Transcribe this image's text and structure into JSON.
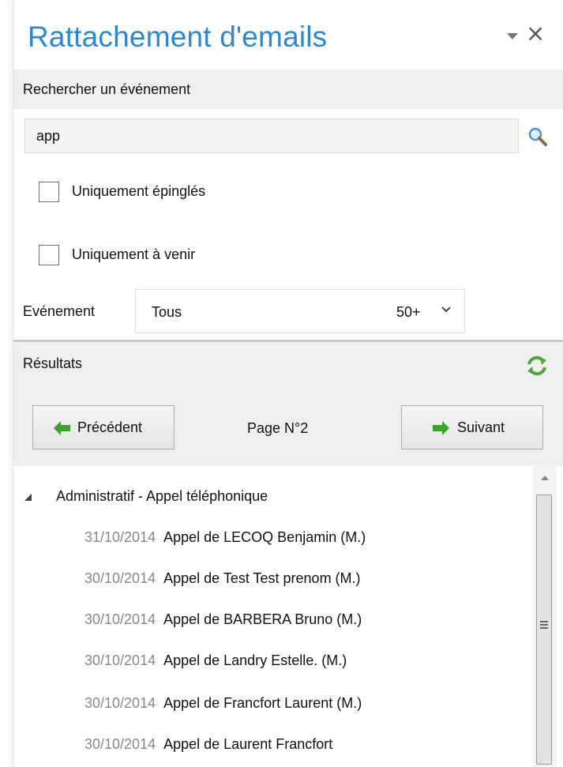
{
  "panel": {
    "title": "Rattachement d'emails",
    "close_glyph": "×"
  },
  "search_section": {
    "header": "Rechercher un événement",
    "input_value": "app",
    "search_icon": "search-icon"
  },
  "filters": {
    "pinned_only": {
      "label": "Uniquement épinglés",
      "checked": false
    },
    "upcoming_only": {
      "label": "Uniquement à venir",
      "checked": false
    }
  },
  "event_filter": {
    "label": "Evénement",
    "selected": "Tous",
    "limit": "50+"
  },
  "results_section": {
    "header": "Résultats",
    "refresh_icon": "refresh-icon"
  },
  "pagination": {
    "prev_label": "Précédent",
    "next_label": "Suivant",
    "page_label": "Page N°2"
  },
  "results": {
    "group": "Administratif - Appel téléphonique",
    "items": [
      {
        "date": "31/10/2014",
        "subject": "Appel de LECOQ Benjamin (M.)"
      },
      {
        "date": "30/10/2014",
        "subject": "Appel de Test Test prenom (M.)"
      },
      {
        "date": "30/10/2014",
        "subject": "Appel de BARBERA Bruno (M.)"
      },
      {
        "date": "30/10/2014",
        "subject": "Appel de Landry Estelle. (M.)"
      },
      {
        "date": "30/10/2014",
        "subject": "Appel de Francfort Laurent (M.)"
      },
      {
        "date": "30/10/2014",
        "subject": "Appel de Laurent Francfort"
      }
    ]
  },
  "colors": {
    "title": "#2e87cf",
    "arrow_green": "#3aa629",
    "header_bg": "#efefef"
  }
}
